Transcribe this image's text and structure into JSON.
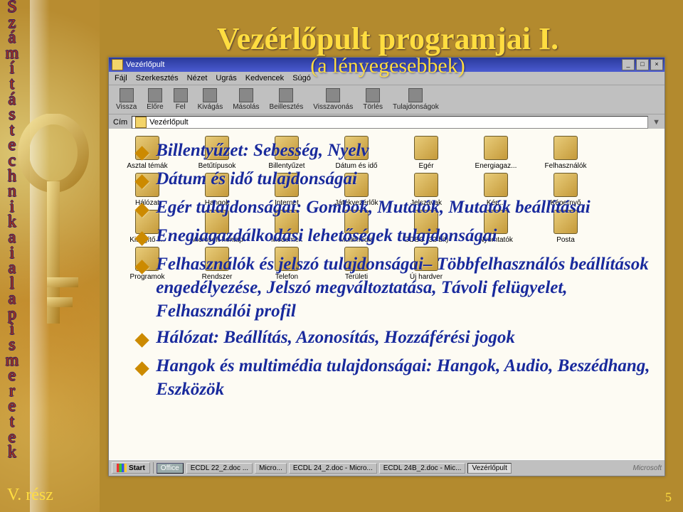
{
  "sidebar_letters": [
    "S",
    "z",
    "á",
    "m",
    "í",
    "t",
    "á",
    "s",
    "t",
    "e",
    "c",
    "h",
    "n",
    "i",
    "k",
    "a",
    "i",
    " ",
    "a",
    "l",
    "a",
    "p",
    "i",
    "s",
    "m",
    "e",
    "r",
    "e",
    "t",
    "e",
    "k"
  ],
  "slide": {
    "title": "Vezérlőpult programjai I.",
    "subtitle": "(a lényegesebbek)",
    "bullets": [
      "Billentyűzet: Sebesség, Nyelv",
      "Dátum és idő tulajdonságai",
      "Egér tulajdonságai: Gombok, Mutatók, Mutatók beállításai",
      "Enegiagazdálkodási lehetőségek tulajdonságai",
      "Felhasználók és jelszó tulajdonságai– Többfelhasználós beállítások engedélyezése, Jelszó megváltoztatása, Távoli felügyelet, Felhasználói profil",
      "Hálózat: Beállítás, Azonosítás, Hozzáférési jogok",
      "Hangok és multimédia tulajdonságai: Hangok, Audio, Beszédhang, Eszközök"
    ],
    "part": "V. rész",
    "page": "5"
  },
  "window": {
    "title": "Vezérlőpult",
    "menu": [
      "Fájl",
      "Szerkesztés",
      "Nézet",
      "Ugrás",
      "Kedvencek",
      "Súgó"
    ],
    "toolbar": [
      "Vissza",
      "Előre",
      "Fel",
      "Kivágás",
      "Másolás",
      "Beillesztés",
      "Visszavonás",
      "Törlés",
      "Tulajdonságok"
    ],
    "addr_label": "Cím",
    "addr_value": "Vezérlőpult",
    "icons_row1": [
      "Asztal témák",
      "Betűtípusok",
      "Billentyűzet",
      "Dátum és idő",
      "Egér",
      "Energiagaz...",
      "Felhasználók"
    ],
    "icons_row2": [
      "Hálózat",
      "Hangok",
      "Internet",
      "Játékvezérlők",
      "Jelszavak",
      "Kép...",
      "Képernyő"
    ],
    "icons_row3": [
      "Kisegítő l...",
      "Microsoft honlap",
      "Modemek",
      "Multimédia",
      "ODBC (32 bit)",
      "Nyomtatók",
      "Posta"
    ],
    "icons_row4": [
      "Programok",
      "Rendszer",
      "Telefon",
      "Területi",
      "Új hardver"
    ],
    "sysbuttons": {
      "min": "_",
      "max": "□",
      "close": "×"
    }
  },
  "taskbar": {
    "start": "Start",
    "items": [
      "ECDL 22_2.doc ...",
      "Micro...",
      "ECDL 24_2.doc - Micro...",
      "ECDL 24B_2.doc - Mic...",
      "Vezérlőpult"
    ],
    "tray_brand": "Microsoft",
    "office_label": "Office"
  }
}
